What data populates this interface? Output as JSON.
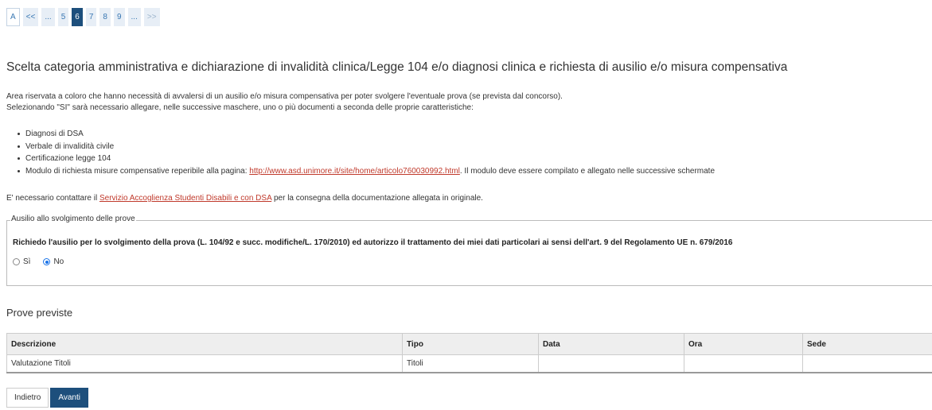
{
  "pagination": {
    "items": [
      {
        "label": "A",
        "state": "first"
      },
      {
        "label": "<<",
        "state": "normal"
      },
      {
        "label": "...",
        "state": "normal"
      },
      {
        "label": "5",
        "state": "normal"
      },
      {
        "label": "6",
        "state": "active"
      },
      {
        "label": "7",
        "state": "normal"
      },
      {
        "label": "8",
        "state": "normal"
      },
      {
        "label": "9",
        "state": "normal"
      },
      {
        "label": "...",
        "state": "normal"
      },
      {
        "label": ">>",
        "state": "disabled"
      }
    ]
  },
  "page": {
    "title": "Scelta categoria amministrativa e dichiarazione di invalidità clinica/Legge 104 e/o diagnosi clinica e richiesta di ausilio e/o misura compensativa",
    "intro_line1": "Area riservata a coloro che hanno necessità di avvalersi di un ausilio e/o misura compensativa per poter svolgere l'eventuale prova (se prevista dal concorso).",
    "intro_line2": "Selezionando \"SI\" sarà necessario allegare, nelle successive maschere, uno o più documenti a seconda delle proprie caratteristiche:"
  },
  "docs": {
    "item1": "Diagnosi di DSA",
    "item2": "Verbale di invalidità civile",
    "item3": "Certificazione legge 104",
    "item4_prefix": "Modulo di richiesta misure compensative reperibile alla pagina: ",
    "item4_link": "http://www.asd.unimore.it/site/home/articolo760030992.html",
    "item4_suffix": ". Il modulo deve essere compilato e allegato nelle successive schermate"
  },
  "contact": {
    "prefix": "E' necessario contattare il ",
    "link": "Servizio Accoglienza Studenti Disabili e con DSA",
    "suffix": " per la consegna della documentazione allegata in originale."
  },
  "ausilio": {
    "legend": "Ausilio allo svolgimento delle prove",
    "question": "Richiedo l'ausilio per lo svolgimento della prova (L. 104/92 e succ. modifiche/L. 170/2010) ed autorizzo il trattamento dei miei dati particolari ai sensi dell'art. 9 del Regolamento UE n. 679/2016",
    "option_si": "Sì",
    "option_no": "No",
    "selected": "No"
  },
  "prove": {
    "title": "Prove previste",
    "headers": {
      "descrizione": "Descrizione",
      "tipo": "Tipo",
      "data": "Data",
      "ora": "Ora",
      "sede": "Sede"
    },
    "rows": [
      {
        "descrizione": "Valutazione Titoli",
        "tipo": "Titoli",
        "data": "",
        "ora": "",
        "sede": ""
      }
    ]
  },
  "buttons": {
    "back": "Indietro",
    "next": "Avanti"
  },
  "colors": {
    "primary": "#1d4f7c",
    "link": "#c0392b",
    "radio": "#1a73e8"
  }
}
